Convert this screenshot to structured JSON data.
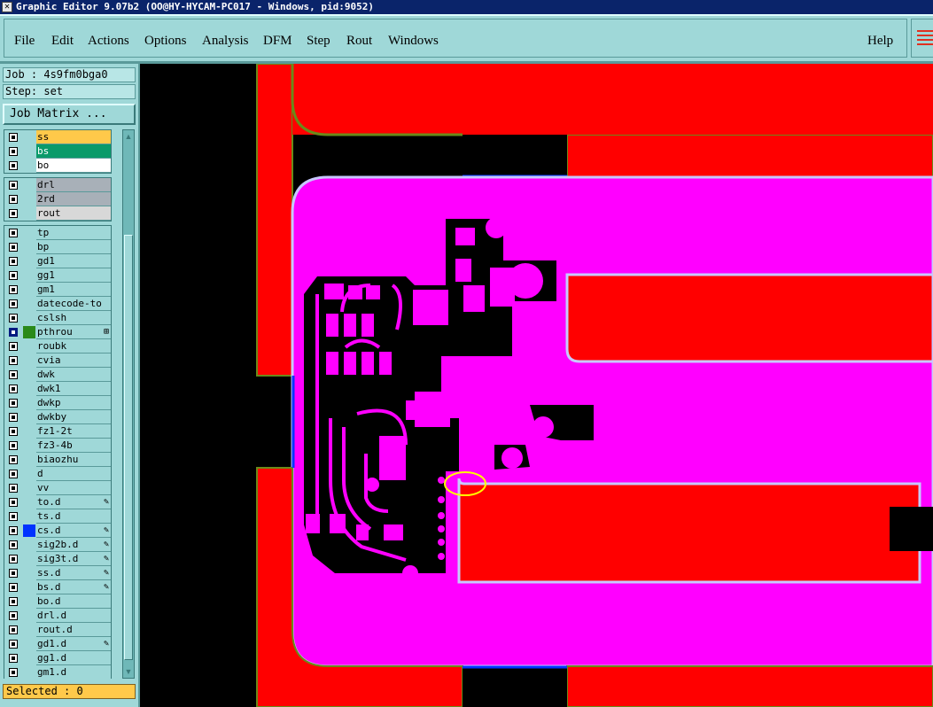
{
  "window": {
    "title": "Graphic Editor 9.07b2 (OO@HY-HYCAM-PC017 - Windows, pid:9052)"
  },
  "menu": {
    "items": [
      "File",
      "Edit",
      "Actions",
      "Options",
      "Analysis",
      "DFM",
      "Step",
      "Rout",
      "Windows"
    ],
    "help": "Help"
  },
  "panel": {
    "job": "Job : 4s9fm0bga0",
    "step": "Step: set",
    "job_matrix": "Job Matrix ...",
    "selected": "Selected : 0"
  },
  "layer_groups": [
    {
      "layers": [
        {
          "name": "ss",
          "swatch": "",
          "bg": "#ffc94a"
        },
        {
          "name": "bs",
          "swatch": "",
          "bg": "#0a9a6a"
        },
        {
          "name": "bo",
          "swatch": "",
          "bg": "#ffffff"
        }
      ]
    },
    {
      "layers": [
        {
          "name": "drl",
          "swatch": "",
          "bg": "#a8b0b8"
        },
        {
          "name": "2rd",
          "swatch": "",
          "bg": "#a8b0b8"
        },
        {
          "name": "rout",
          "swatch": "",
          "bg": "#d8d8d8"
        }
      ]
    },
    {
      "layers": [
        {
          "name": "tp"
        },
        {
          "name": "bp"
        },
        {
          "name": "gd1"
        },
        {
          "name": "gg1"
        },
        {
          "name": "gm1"
        },
        {
          "name": "datecode-to"
        },
        {
          "name": "cslsh"
        },
        {
          "name": "pthrou",
          "on": true,
          "swatch": "#2a8a1a",
          "mark": "⊞"
        },
        {
          "name": "roubk"
        },
        {
          "name": "cvia"
        },
        {
          "name": "dwk"
        },
        {
          "name": "dwk1"
        },
        {
          "name": "dwkp"
        },
        {
          "name": "dwkby"
        },
        {
          "name": "fz1-2t"
        },
        {
          "name": "fz3-4b"
        },
        {
          "name": "biaozhu"
        },
        {
          "name": "d"
        },
        {
          "name": "vv"
        },
        {
          "name": "to.d",
          "mark": "✎"
        },
        {
          "name": "ts.d"
        },
        {
          "name": "cs.d",
          "swatch": "#0033ff",
          "mark": "✎"
        },
        {
          "name": "sig2b.d",
          "mark": "✎"
        },
        {
          "name": "sig3t.d",
          "mark": "✎"
        },
        {
          "name": "ss.d",
          "mark": "✎"
        },
        {
          "name": "bs.d",
          "mark": "✎"
        },
        {
          "name": "bo.d"
        },
        {
          "name": "drl.d"
        },
        {
          "name": "rout.d"
        },
        {
          "name": "gd1.d",
          "mark": "✎"
        },
        {
          "name": "gg1.d"
        },
        {
          "name": "gm1.d"
        }
      ]
    }
  ],
  "colors": {
    "copper": "#ff0000",
    "board": "#ff00ff",
    "outline": "#c8c8ff",
    "edge": "#6a8a1a",
    "background": "#000000",
    "highlight": "#ffff00"
  }
}
